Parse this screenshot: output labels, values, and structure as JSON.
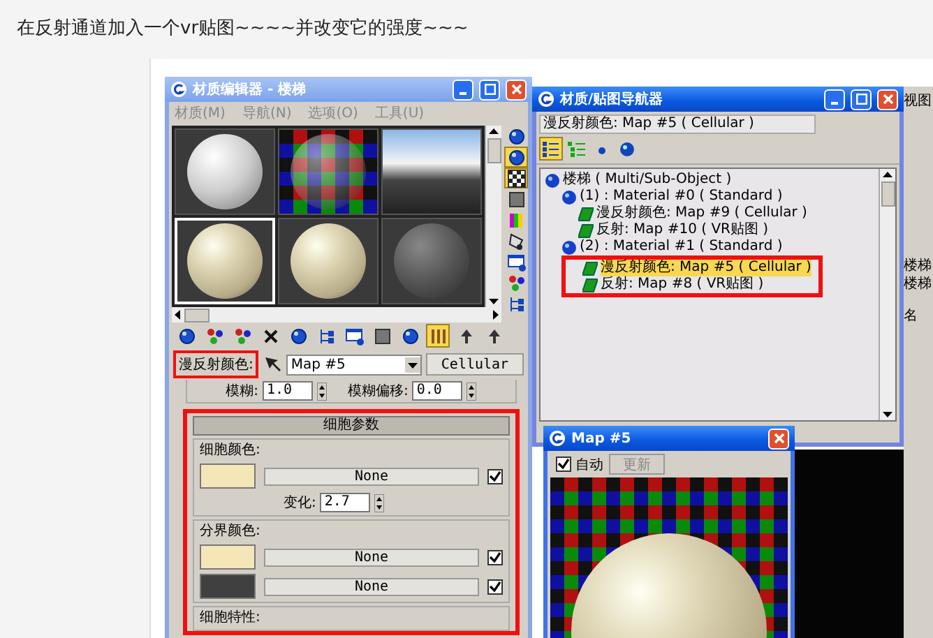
{
  "caption": "在反射通道加入一个vr贴图~~~~并改变它的强度~~~",
  "material_editor": {
    "title": "材质编辑器 - 楼梯",
    "menu": [
      "材质(M)",
      "导航(N)",
      "选项(O)",
      "工具(U)"
    ],
    "slots": [
      {
        "kind": "white",
        "selected": false
      },
      {
        "kind": "checker",
        "selected": false
      },
      {
        "kind": "sky",
        "selected": false
      },
      {
        "kind": "stone",
        "selected": true
      },
      {
        "kind": "stone",
        "selected": false
      },
      {
        "kind": "dark",
        "selected": false
      }
    ],
    "side_tools": [
      {
        "kind": "ball",
        "on": false
      },
      {
        "kind": "ball",
        "on": true
      },
      {
        "kind": "checker",
        "on": true
      },
      {
        "kind": "square",
        "on": false
      },
      {
        "kind": "stripes",
        "on": false
      },
      {
        "kind": "film",
        "on": false
      },
      {
        "kind": "window",
        "on": false
      },
      {
        "kind": "dots",
        "on": false
      },
      {
        "kind": "tree",
        "on": false
      }
    ],
    "bottom_tools": [
      {
        "kind": "ball",
        "on": false
      },
      {
        "kind": "dots",
        "on": false
      },
      {
        "kind": "dots",
        "on": false
      },
      {
        "kind": "cross",
        "on": false
      },
      {
        "kind": "ball",
        "on": false
      },
      {
        "kind": "tree",
        "on": false
      },
      {
        "kind": "window",
        "on": false
      },
      {
        "kind": "square",
        "on": false
      },
      {
        "kind": "ball",
        "on": false
      },
      {
        "kind": "bars",
        "on": true
      },
      {
        "kind": "arrow",
        "on": false
      },
      {
        "kind": "arrow",
        "on": false
      }
    ],
    "map_row": {
      "label": "漫反射颜色:",
      "highlighted": true,
      "map": "Map #5",
      "type": "Cellular"
    },
    "blur": {
      "label": "模糊:",
      "value": "1.0",
      "offset_label": "模糊偏移:",
      "offset_value": "0.0"
    },
    "rollout": {
      "title": "细胞参数",
      "highlighted": true,
      "groups": [
        {
          "title": "细胞颜色:",
          "rows": [
            {
              "color": "#f5e6b8",
              "map": "None",
              "checked": true
            }
          ],
          "variation_label": "变化:",
          "variation": "2.7"
        },
        {
          "title": "分界颜色:",
          "rows": [
            {
              "color": "#f5e6b8",
              "map": "None",
              "checked": true
            },
            {
              "color": "#404040",
              "map": "None",
              "checked": true
            }
          ]
        },
        {
          "title": "细胞特性:"
        }
      ]
    }
  },
  "navigator": {
    "title": "材质/贴图导航器",
    "path": "漫反射颜色: Map #5 ( Cellular )",
    "tree": [
      {
        "label": "楼梯 ( Multi/Sub-Object )",
        "kind": "material",
        "selected": false,
        "highlighted": false,
        "children": [
          {
            "label": "(1) : Material #0 ( Standard )",
            "kind": "material",
            "selected": false,
            "highlighted": false,
            "children": [
              {
                "label": "漫反射颜色: Map #9 ( Cellular )",
                "kind": "map",
                "selected": false
              },
              {
                "label": "反射: Map #10 ( VR贴图 )",
                "kind": "map",
                "selected": false
              }
            ]
          },
          {
            "label": "(2) : Material #1 ( Standard )",
            "kind": "material",
            "selected": false,
            "highlighted": true,
            "children": [
              {
                "label": "漫反射颜色: Map #5 ( Cellular )",
                "kind": "map",
                "selected": true
              },
              {
                "label": "反射: Map #8 ( VR贴图 )",
                "kind": "map",
                "selected": false
              }
            ]
          }
        ]
      }
    ]
  },
  "map_window": {
    "title": "Map #5",
    "auto_label": "自动",
    "auto_checked": true,
    "update": "更新",
    "update_disabled": true
  },
  "right_strip": {
    "labels": [
      "视图",
      "楼梯",
      "楼梯",
      "名"
    ]
  }
}
